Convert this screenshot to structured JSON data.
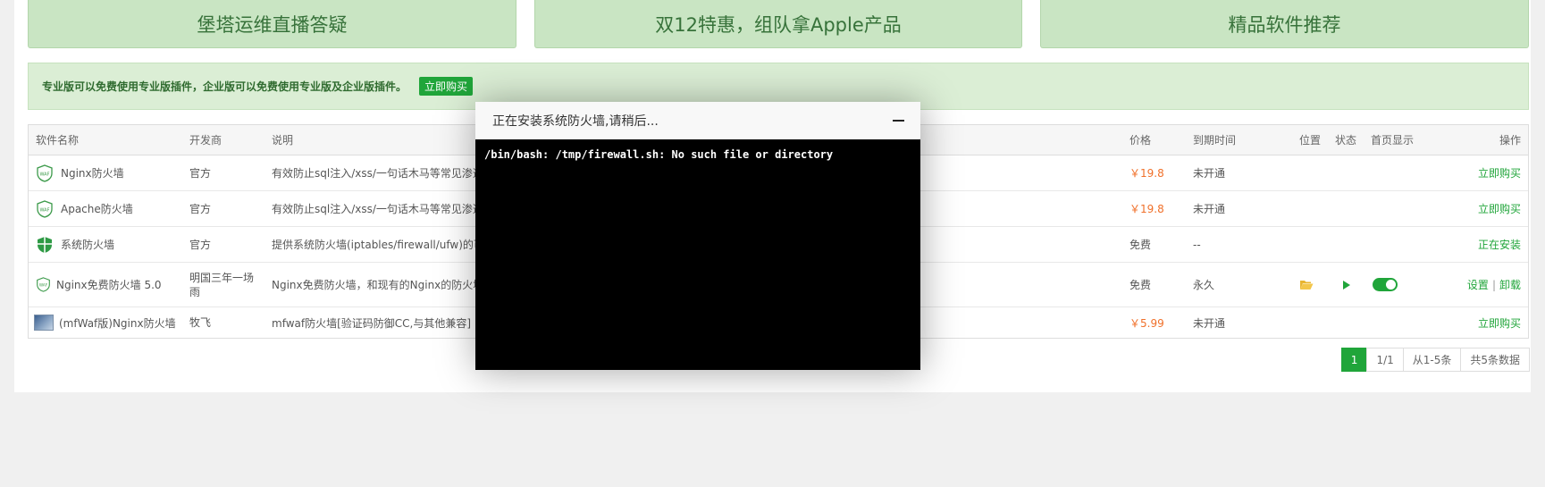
{
  "banners": [
    {
      "label": "堡塔运维直播答疑"
    },
    {
      "label": "双12特惠，组队拿Apple产品"
    },
    {
      "label": "精品软件推荐"
    }
  ],
  "notice": {
    "text": "专业版可以免费使用专业版插件，企业版可以免费使用专业版及企业版插件。",
    "button": "立即购买"
  },
  "table": {
    "headers": {
      "name": "软件名称",
      "developer": "开发商",
      "description": "说明",
      "price": "价格",
      "expire": "到期时间",
      "position": "位置",
      "status": "状态",
      "home": "首页显示",
      "operation": "操作"
    },
    "rows": [
      {
        "name": "Nginx防火墙",
        "developer": "官方",
        "description": "有效防止sql注入/xss/一句话木马等常见渗透",
        "price": "￥19.8",
        "expire": "未开通",
        "operation": "立即购买",
        "icon": "waf-shield-icon"
      },
      {
        "name": "Apache防火墙",
        "developer": "官方",
        "description": "有效防止sql注入/xss/一句话木马等常见渗透",
        "price": "￥19.8",
        "expire": "未开通",
        "operation": "立即购买",
        "icon": "waf-shield-icon"
      },
      {
        "name": "系统防火墙",
        "developer": "官方",
        "description": "提供系统防火墙(iptables/firewall/ufw)的可",
        "price": "免费",
        "expire": "--",
        "operation": "正在安装",
        "icon": "green-shield-icon"
      },
      {
        "name": "Nginx免费防火墙 5.0",
        "developer": "明国三年一场雨",
        "description": "Nginx免费防火墙，和现有的Nginx的防火墙",
        "price": "免费",
        "expire": "永久",
        "operation_set": "设置",
        "operation_sep": "|",
        "operation_uninstall": "卸载",
        "icon": "waf-shield-icon",
        "home_enabled": true
      },
      {
        "name": "(mfWaf版)Nginx防火墙",
        "developer": "牧飞",
        "description": "mfwaf防火墙[验证码防御CC,与其他兼容]",
        "price": "￥5.99",
        "expire": "未开通",
        "operation": "立即购买",
        "icon": "thumbnail-icon"
      }
    ]
  },
  "pager": {
    "current": "1",
    "pages": "1/1",
    "range": "从1-5条",
    "total": "共5条数据"
  },
  "dialog": {
    "title": "正在安装系统防火墙,请稍后...",
    "output": "/bin/bash: /tmp/firewall.sh: No such file or directory"
  },
  "colors": {
    "accent": "#20a53a",
    "price": "#f0702a",
    "banner": "#c9e5c3"
  }
}
